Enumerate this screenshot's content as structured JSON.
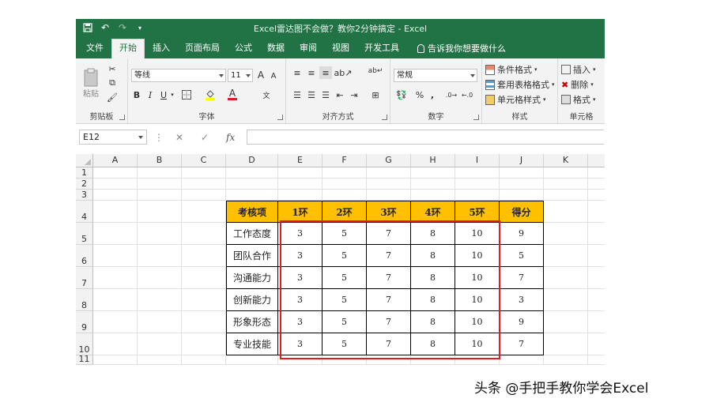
{
  "window": {
    "title": "Excel雷达图不会做？教你2分钟搞定  -  Excel"
  },
  "tabs": [
    "文件",
    "开始",
    "插入",
    "页面布局",
    "公式",
    "数据",
    "审阅",
    "视图",
    "开发工具"
  ],
  "active_tab": "开始",
  "tell_me": "告诉我你想要做什么",
  "ribbon": {
    "clipboard": {
      "label": "剪贴板",
      "paste": "粘贴"
    },
    "font": {
      "label": "字体",
      "name": "等线",
      "size": "11",
      "bold": "B",
      "italic": "I",
      "underline": "U",
      "grow": "A",
      "shrink": "A"
    },
    "alignment": {
      "label": "对齐方式"
    },
    "number": {
      "label": "数字",
      "format": "常规",
      "percent": "%",
      "comma": ","
    },
    "styles": {
      "label": "样式",
      "conditional": "条件格式",
      "table": "套用表格格式",
      "cell_styles": "单元格样式"
    },
    "cells": {
      "label": "单元格",
      "insert": "插入",
      "delete": "删除",
      "format": "格式"
    }
  },
  "formula_bar": {
    "name_box": "E12",
    "fx": "fx",
    "formula": ""
  },
  "columns": [
    "A",
    "B",
    "C",
    "D",
    "E",
    "F",
    "G",
    "H",
    "I",
    "J",
    "K"
  ],
  "rows": [
    "1",
    "2",
    "3",
    "4",
    "5",
    "6",
    "7",
    "8",
    "9",
    "10",
    "11"
  ],
  "table": {
    "headers": [
      "考核项",
      "1环",
      "2环",
      "3环",
      "4环",
      "5环",
      "得分"
    ],
    "rows": [
      [
        "工作态度",
        "3",
        "5",
        "7",
        "8",
        "10",
        "9"
      ],
      [
        "团队合作",
        "3",
        "5",
        "7",
        "8",
        "10",
        "5"
      ],
      [
        "沟通能力",
        "3",
        "5",
        "7",
        "8",
        "10",
        "7"
      ],
      [
        "创新能力",
        "3",
        "5",
        "7",
        "8",
        "10",
        "3"
      ],
      [
        "形象形态",
        "3",
        "5",
        "7",
        "8",
        "10",
        "9"
      ],
      [
        "专业技能",
        "3",
        "5",
        "7",
        "8",
        "10",
        "7"
      ]
    ]
  },
  "colors": {
    "excel_green": "#217346",
    "header_fill": "#ffc000",
    "highlight_border": "#e11b22"
  },
  "watermark": "头条 @手把手教你学会Excel"
}
